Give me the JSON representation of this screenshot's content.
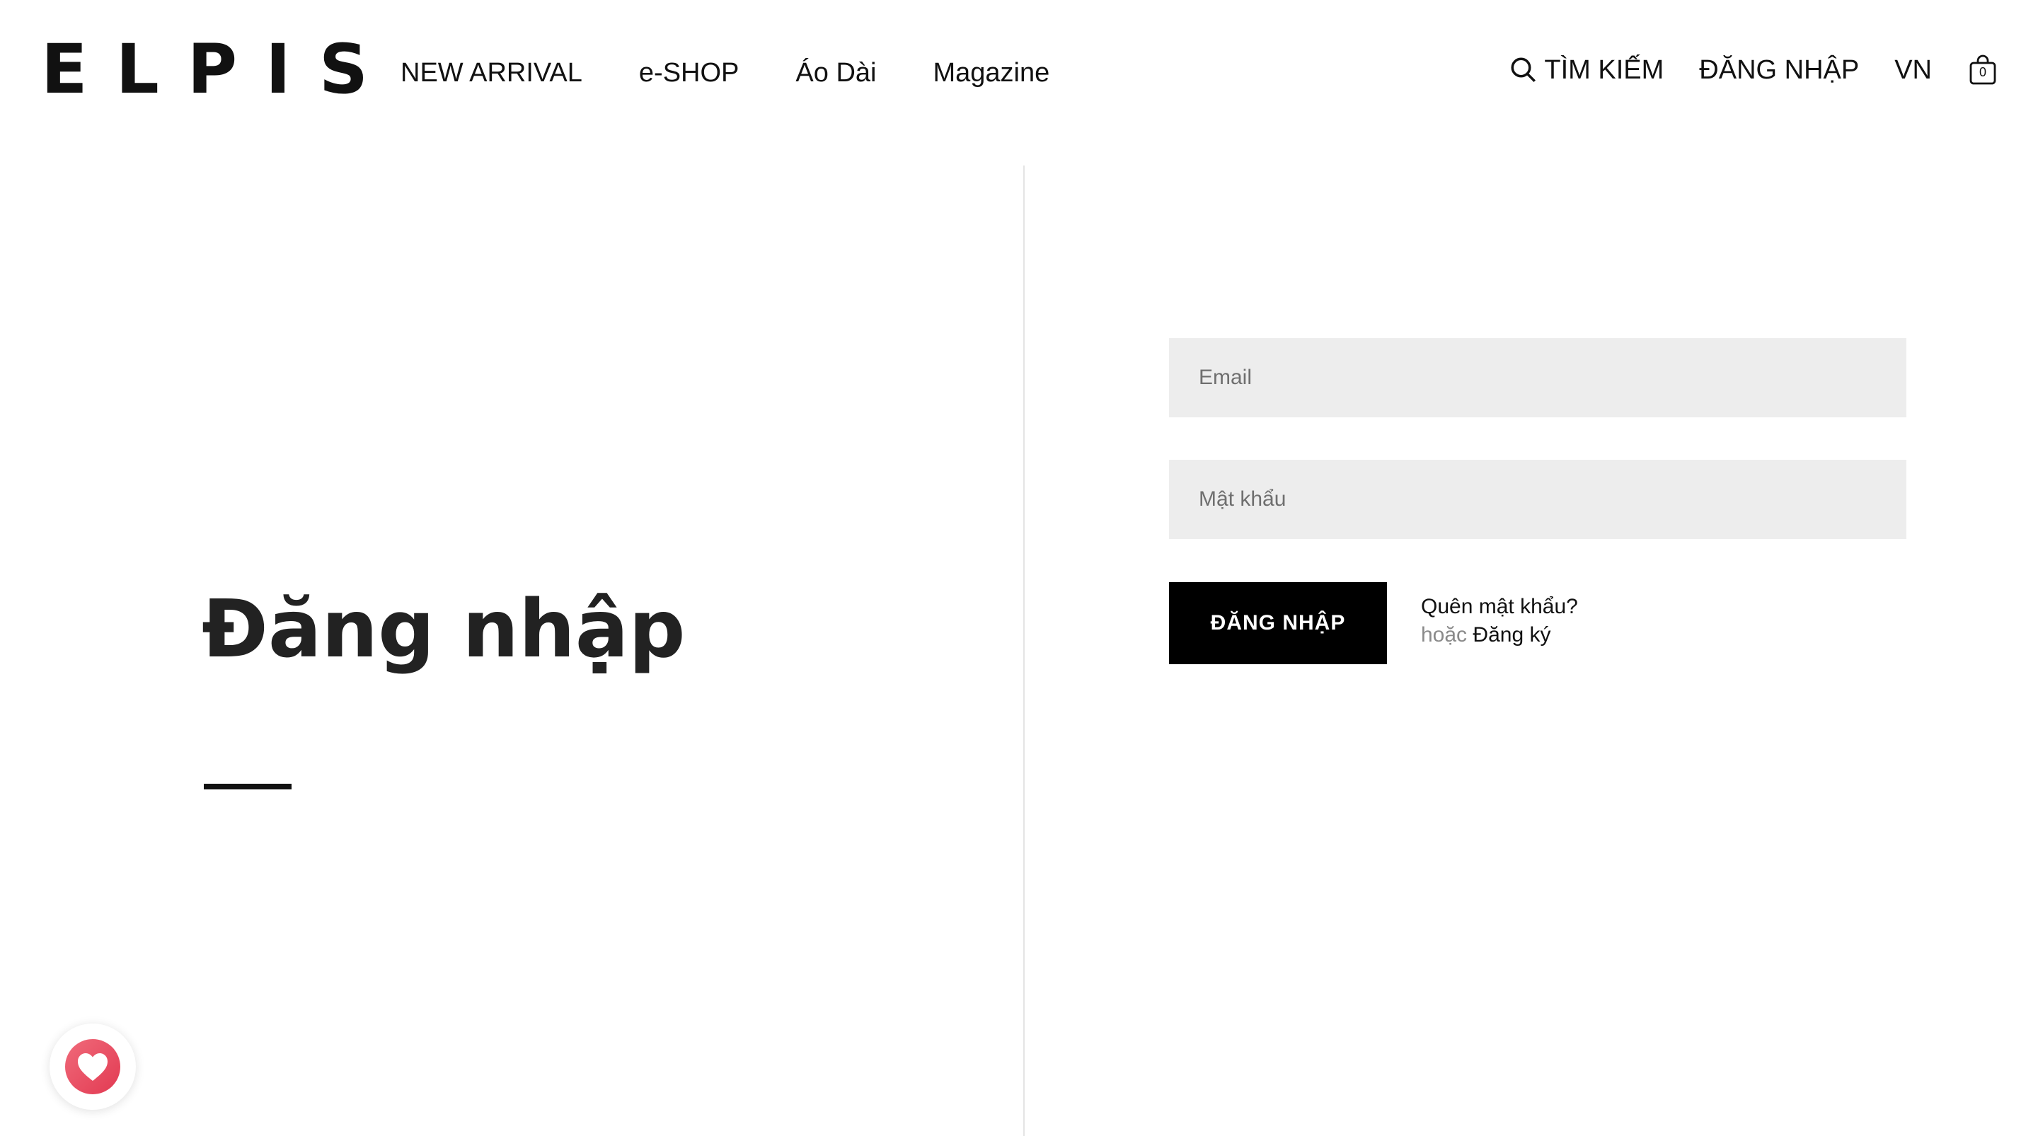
{
  "brand": {
    "logo_text": "ELPIS"
  },
  "nav": {
    "items": [
      {
        "label": "NEW ARRIVAL"
      },
      {
        "label": "e-SHOP"
      },
      {
        "label": "Áo Dài"
      },
      {
        "label": "Magazine"
      }
    ]
  },
  "header_right": {
    "search_label": "TÌM KIẾM",
    "search_icon": "search-icon",
    "login_label": "ĐĂNG NHẬP",
    "language_label": "VN",
    "cart_icon": "shopping-bag-icon",
    "cart_count": "0"
  },
  "page": {
    "title": "Đăng nhập"
  },
  "form": {
    "email_placeholder": "Email",
    "email_value": "",
    "password_placeholder": "Mật khẩu",
    "password_value": "",
    "submit_label": "ĐĂNG NHẬP",
    "forgot_label": "Quên mật khẩu?",
    "or_label": "hoặc",
    "register_label": "Đăng ký"
  },
  "floating": {
    "icon": "heart-icon",
    "accent": "#e23a52"
  },
  "colors": {
    "text": "#111111",
    "input_bg": "#ededed",
    "button_bg": "#000000",
    "divider": "#e4e4e4"
  }
}
